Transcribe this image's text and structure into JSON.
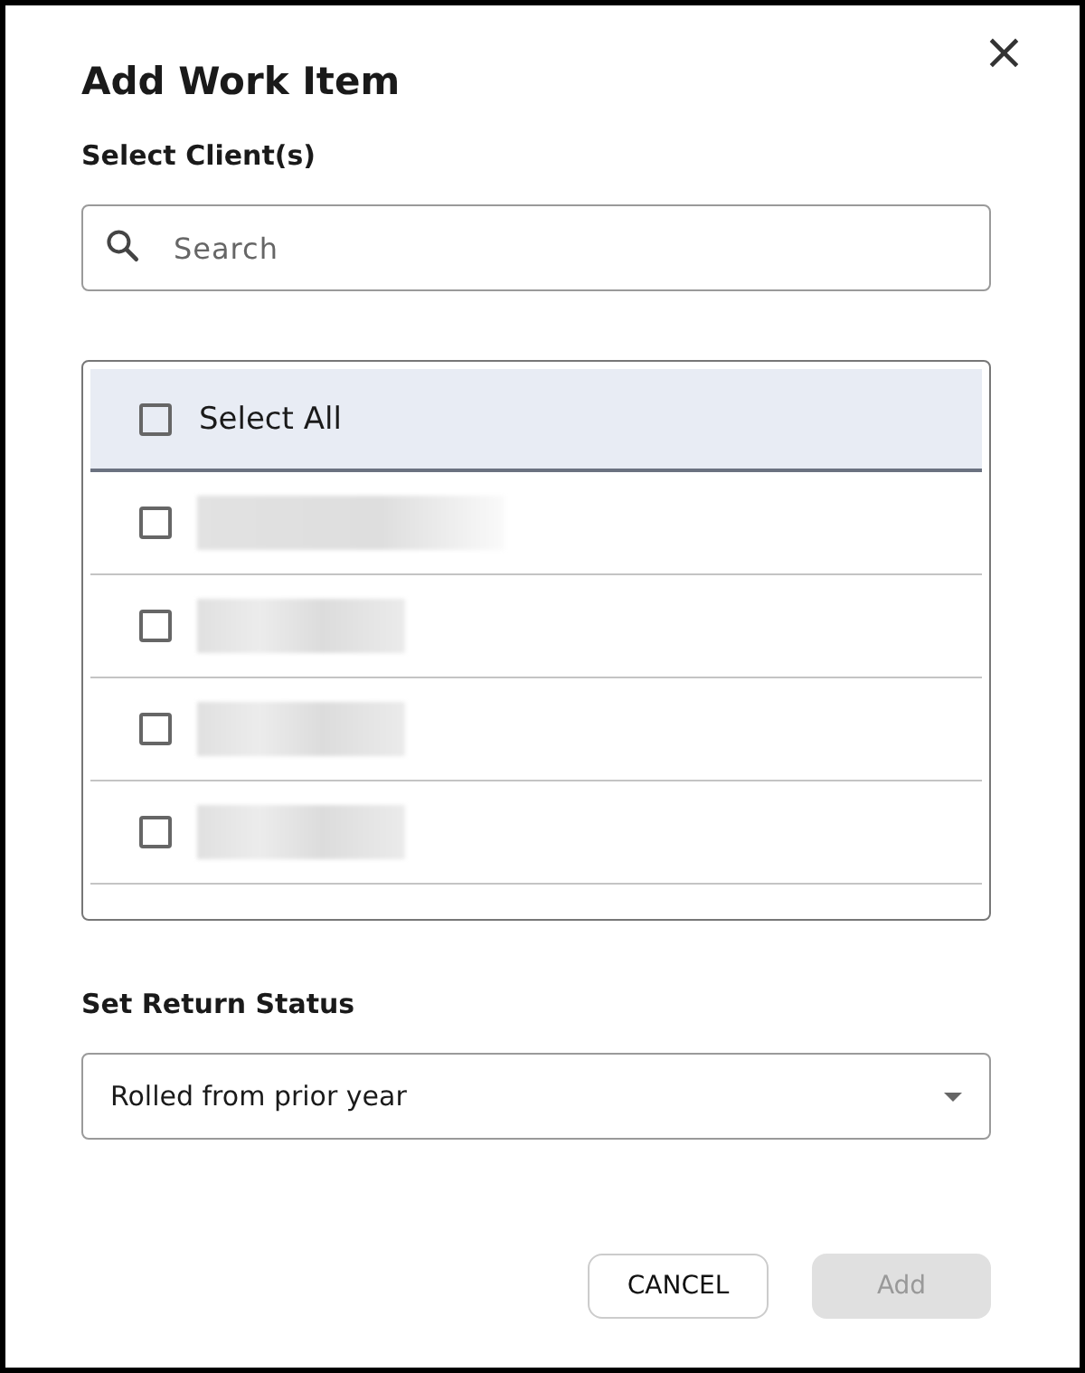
{
  "dialog": {
    "title": "Add Work Item",
    "close": "×"
  },
  "clients": {
    "label": "Select Client(s)",
    "search": {
      "placeholder": "Search"
    },
    "select_all": {
      "label": "Select All",
      "checked": false
    },
    "rows": [
      {
        "kind": "redacted",
        "checked": false
      },
      {
        "kind": "redacted",
        "checked": false
      },
      {
        "kind": "redacted",
        "checked": false
      },
      {
        "kind": "redacted",
        "checked": false
      }
    ]
  },
  "return_status": {
    "label": "Set Return Status",
    "value": "Rolled from prior year"
  },
  "buttons": [
    {
      "label": "CANCEL",
      "disabled": false
    },
    {
      "label": "Add",
      "disabled": true
    }
  ]
}
